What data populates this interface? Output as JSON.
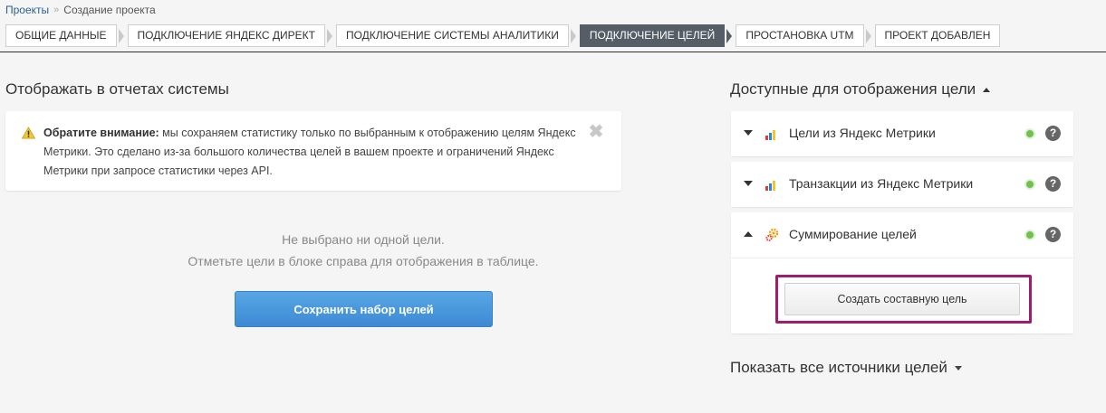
{
  "breadcrumb": {
    "root": "Проекты",
    "separator": "»",
    "current": "Создание проекта"
  },
  "steps": [
    {
      "label": "ОБЩИЕ ДАННЫЕ",
      "active": false
    },
    {
      "label": "ПОДКЛЮЧЕНИЕ ЯНДЕКС ДИРЕКТ",
      "active": false
    },
    {
      "label": "ПОДКЛЮЧЕНИЕ СИСТЕМЫ АНАЛИТИКИ",
      "active": false
    },
    {
      "label": "ПОДКЛЮЧЕНИЕ ЦЕЛЕЙ",
      "active": true
    },
    {
      "label": "ПРОСТАНОВКА UTM",
      "active": false
    },
    {
      "label": "ПРОЕКТ ДОБАВЛЕН",
      "active": false
    }
  ],
  "left": {
    "title": "Отображать в отчетах системы",
    "notice": {
      "icon": "warning-icon",
      "bold": "Обратите внимание:",
      "text": " мы сохраняем статистику только по выбранным к отображению целям Яндекс Метрики. Это сделано из-за большого количества целей в вашем проекте и ограничений Яндекс Метрики при запросе статистики через API."
    },
    "empty_line1": "Не выбрано ни одной цели.",
    "empty_line2": "Отметьте цели в блоке справа для отображения в таблице.",
    "save_button": "Сохранить набор целей"
  },
  "right": {
    "title": "Доступные для отображения цели",
    "sources": [
      {
        "label": "Цели из Яндекс Метрики",
        "icon": "metrika-chart-icon",
        "expanded": false
      },
      {
        "label": "Транзакции из Яндекс Метрики",
        "icon": "metrika-chart-icon",
        "expanded": false
      },
      {
        "label": "Суммирование целей",
        "icon": "gears-icon",
        "expanded": true
      }
    ],
    "help_glyph": "?",
    "compose_button": "Создать составную цель",
    "show_all": "Показать все источники целей"
  },
  "colors": {
    "active_step": "#555d66",
    "primary_button": "#4a97dc",
    "highlight": "#9c1f6e",
    "status_ok": "#6fc04f"
  }
}
